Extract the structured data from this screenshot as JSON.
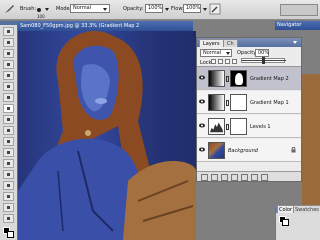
{
  "options_bar": {
    "brush_label": "Brush:",
    "brush_size": "100",
    "mode_label": "Mode:",
    "mode_value": "Normal",
    "opacity_label": "Opacity:",
    "opacity_value": "100%",
    "flow_label": "Flow:",
    "flow_value": "100%"
  },
  "document": {
    "title": "Sam080_F50gpm.jpg @ 33.3% (Gradient Map 2"
  },
  "second_document": {
    "title": "Navigator"
  },
  "layers_panel": {
    "tabs": [
      "Layers",
      "Ch"
    ],
    "blend_mode": "Normal",
    "opacity_label": "Opacity:",
    "opacity_value": "00%",
    "lock_label": "Lock:",
    "fill_label": "Fill:",
    "layers": [
      {
        "name": "Gradient Map 2",
        "selected": true,
        "type": "adjustment"
      },
      {
        "name": "Gradient Map 1",
        "selected": false,
        "type": "adjustment"
      },
      {
        "name": "Levels 1",
        "selected": false,
        "type": "levels"
      },
      {
        "name": "Background",
        "selected": false,
        "type": "image"
      }
    ]
  },
  "color_panel": {
    "tabs": [
      "Color",
      "Swatches"
    ]
  },
  "colors": {
    "options_bg": "#d9d9d9",
    "title_bar": "#2e4f94",
    "selected_layer": "#c2c2cf",
    "denim": "#334aa0",
    "hair": "#8b4a22"
  }
}
